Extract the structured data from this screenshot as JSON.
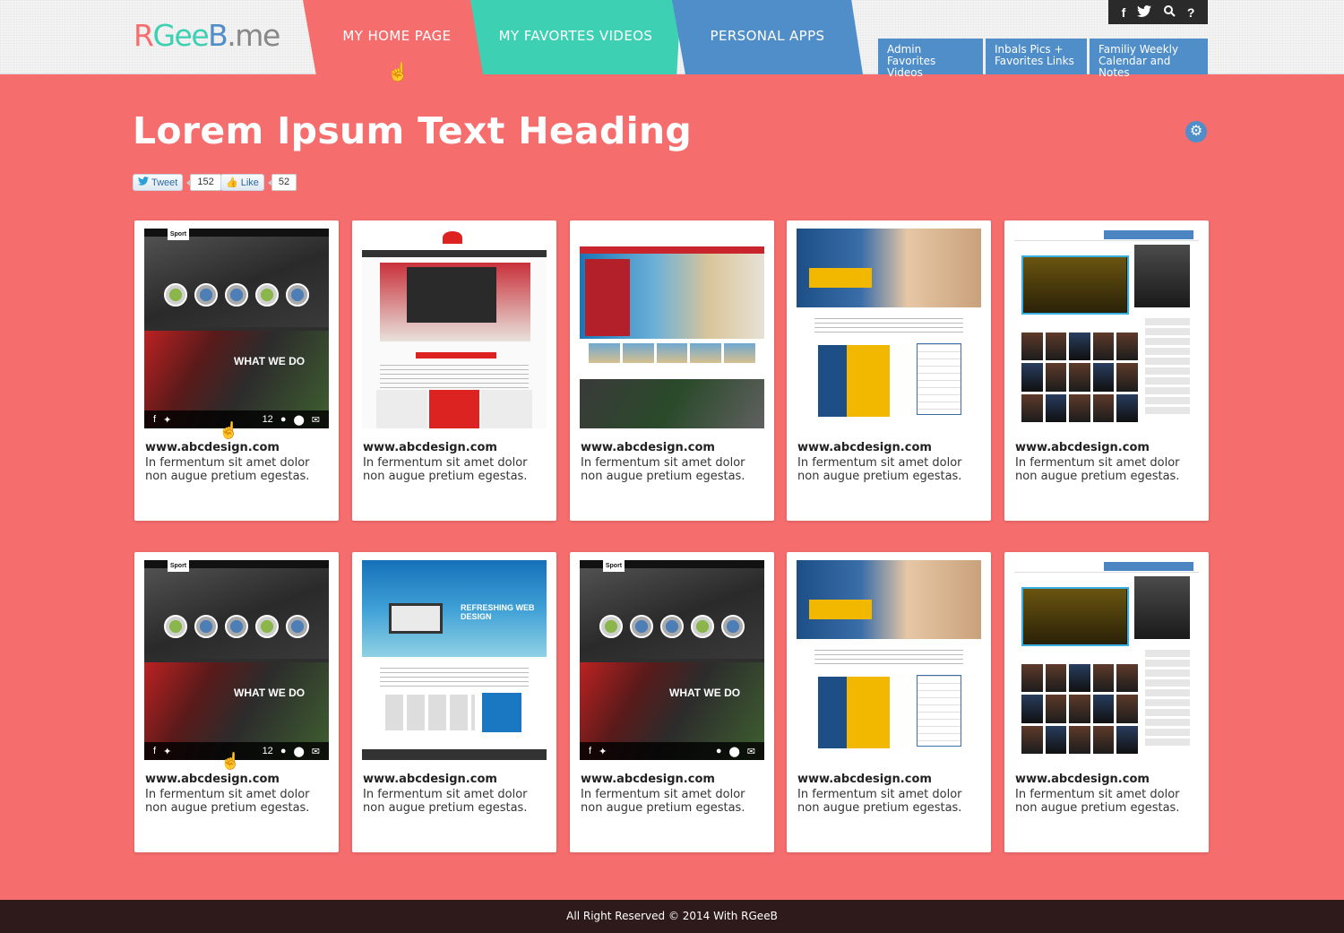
{
  "logo": {
    "letters": [
      {
        "char": "R",
        "color": "#f56d6d"
      },
      {
        "char": "G",
        "color": "#3dd0b3"
      },
      {
        "char": "e",
        "color": "#3dd0b3"
      },
      {
        "char": "e",
        "color": "#3dd0b3"
      },
      {
        "char": "B",
        "color": "#4f8ec8"
      },
      {
        "char": ".",
        "color": "#888888"
      },
      {
        "char": "m",
        "color": "#888888"
      },
      {
        "char": "e",
        "color": "#888888"
      }
    ]
  },
  "nav": {
    "tabs": [
      {
        "label": "MY HOME PAGE",
        "color": "#f56d6d"
      },
      {
        "label": "MY FAVORTES VIDEOS",
        "color": "#3dd0b3"
      },
      {
        "label": "PERSONAL APPS",
        "color": "#4f8ec8"
      }
    ],
    "subtabs": [
      {
        "line1": "Admin",
        "line2": "Favorites Videos"
      },
      {
        "line1": "Inbals Pics +",
        "line2": "Favorites Links"
      },
      {
        "line1": "Familiy Weekly",
        "line2": "Calendar and Notes"
      }
    ],
    "social_icons": [
      "facebook-icon",
      "twitter-icon",
      "search-icon",
      "help-icon"
    ]
  },
  "page": {
    "heading": "Lorem Ipsum Text Heading",
    "tweet_label": "Tweet",
    "tweet_count": "152",
    "like_label": "Like",
    "like_count": "52"
  },
  "cards": [
    {
      "url": "www.abcdesign.com",
      "desc": "In fermentum sit amet dolor non augue pretium egestas.",
      "thumb": "sport",
      "count": "12"
    },
    {
      "url": "www.abcdesign.com",
      "desc": "In fermentum sit amet dolor non augue pretium egestas.",
      "thumb": "arabic"
    },
    {
      "url": "www.abcdesign.com",
      "desc": "In fermentum sit amet dolor non augue pretium egestas.",
      "thumb": "travel"
    },
    {
      "url": "www.abcdesign.com",
      "desc": "In fermentum sit amet dolor non augue pretium egestas.",
      "thumb": "tech"
    },
    {
      "url": "www.abcdesign.com",
      "desc": "In fermentum sit amet dolor non augue pretium egestas.",
      "thumb": "movies"
    },
    {
      "url": "www.abcdesign.com",
      "desc": "In fermentum sit amet dolor non augue pretium egestas.",
      "thumb": "sport",
      "count": "12"
    },
    {
      "url": "www.abcdesign.com",
      "desc": "In fermentum sit amet dolor non augue pretium egestas.",
      "thumb": "store"
    },
    {
      "url": "www.abcdesign.com",
      "desc": "In fermentum sit amet dolor non augue pretium egestas.",
      "thumb": "sport-plain"
    },
    {
      "url": "www.abcdesign.com",
      "desc": "In fermentum sit amet dolor non augue pretium egestas.",
      "thumb": "tech"
    },
    {
      "url": "www.abcdesign.com",
      "desc": "In fermentum sit amet dolor non augue pretium egestas.",
      "thumb": "movies"
    }
  ],
  "thumb_text": {
    "sport_brand": "Sport",
    "what_we_do": "WHAT WE DO",
    "store_headline": "REFRESHING WEB DESIGN"
  },
  "footer": {
    "text": "All Right Reserved © 2014  With RGeeB"
  }
}
